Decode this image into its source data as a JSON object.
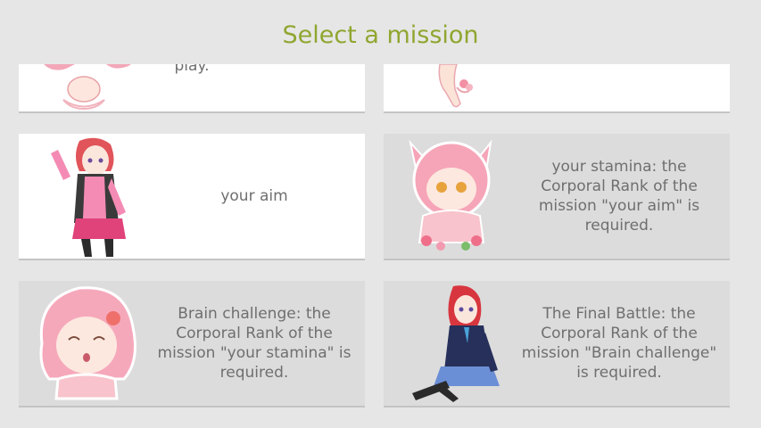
{
  "header": {
    "title": "Select a mission"
  },
  "missions": [
    {
      "text": "play.",
      "locked": false
    },
    {
      "text": "",
      "locked": false
    },
    {
      "text": "your aim",
      "locked": false
    },
    {
      "text": "your stamina: the Corporal Rank of the mission \"your aim\" is required.",
      "locked": true
    },
    {
      "text": "Brain challenge: the Corporal Rank of the mission \"your stamina\" is required.",
      "locked": true
    },
    {
      "text": "The Final Battle: the Corporal Rank of the mission \"Brain challenge\" is required.",
      "locked": true
    }
  ],
  "colors": {
    "title": "#8fa630",
    "card_unlocked": "#ffffff",
    "card_locked": "#dcdcdc",
    "text": "#6f6f6f"
  }
}
